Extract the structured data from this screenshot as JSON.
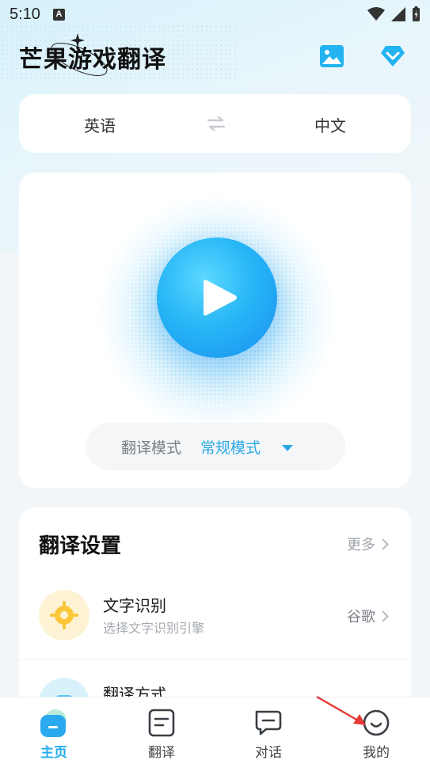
{
  "status_bar": {
    "time": "5:10",
    "notification_badge": "A"
  },
  "header": {
    "app_title": "芒果游戏翻译",
    "icons": [
      "image-icon",
      "vip-diamond-icon"
    ]
  },
  "language_selector": {
    "source": "英语",
    "target": "中文",
    "swap_icon": "swap-arrows-icon"
  },
  "player": {
    "play_icon": "play-icon",
    "mode_label": "翻译模式",
    "mode_value": "常规模式",
    "mode_caret_icon": "caret-down-icon"
  },
  "settings": {
    "title": "翻译设置",
    "more_label": "更多",
    "rows": [
      {
        "title": "文字识别",
        "subtitle": "选择文字识别引擎",
        "value": "谷歌",
        "icon": "target-crosshair-icon"
      },
      {
        "title": "翻译方式",
        "subtitle": "",
        "value": "",
        "icon": "translate-method-icon"
      }
    ]
  },
  "tabbar": {
    "tabs": [
      {
        "label": "主页",
        "icon": "home-icon",
        "active": true
      },
      {
        "label": "翻译",
        "icon": "document-icon",
        "active": false
      },
      {
        "label": "对话",
        "icon": "chat-icon",
        "active": false
      },
      {
        "label": "我的",
        "icon": "profile-smile-icon",
        "active": false
      }
    ]
  },
  "colors": {
    "accent": "#27AEF0",
    "accent_deep": "#1A8FF0",
    "page_bg": "#F3F6F9",
    "annotation_arrow": "#E53935"
  }
}
